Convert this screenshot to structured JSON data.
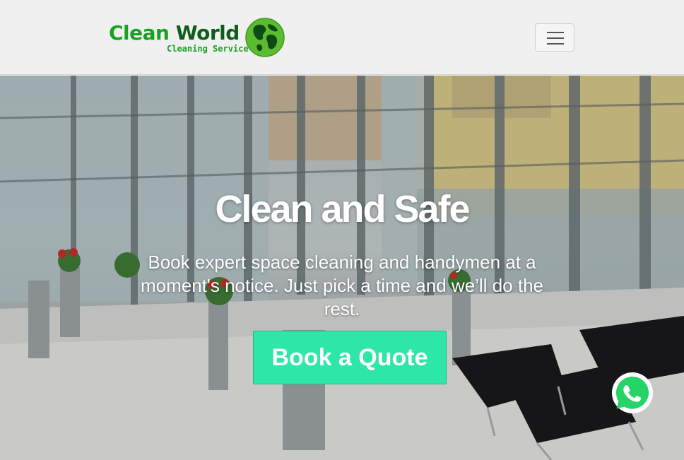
{
  "brand": {
    "name_part1": "Clean",
    "name_part2": "World",
    "tagline": "Cleaning Service",
    "logo_icon": "globe-icon"
  },
  "navbar": {
    "toggle_icon": "hamburger-menu-icon"
  },
  "hero": {
    "title": "Clean and Safe",
    "subtitle": "Book expert space cleaning and handymen at a moment's notice. Just pick a time and we’ll do the rest.",
    "cta_label": "Book a Quote",
    "background": "office-lobby-image"
  },
  "floating": {
    "whatsapp_icon": "whatsapp-icon"
  },
  "colors": {
    "brand_green": "#17a21f",
    "brand_dark_green": "#0f5d1a",
    "cta": "#2ee6a8",
    "whatsapp": "#25d366",
    "navbar_bg": "#f0f0f0"
  }
}
